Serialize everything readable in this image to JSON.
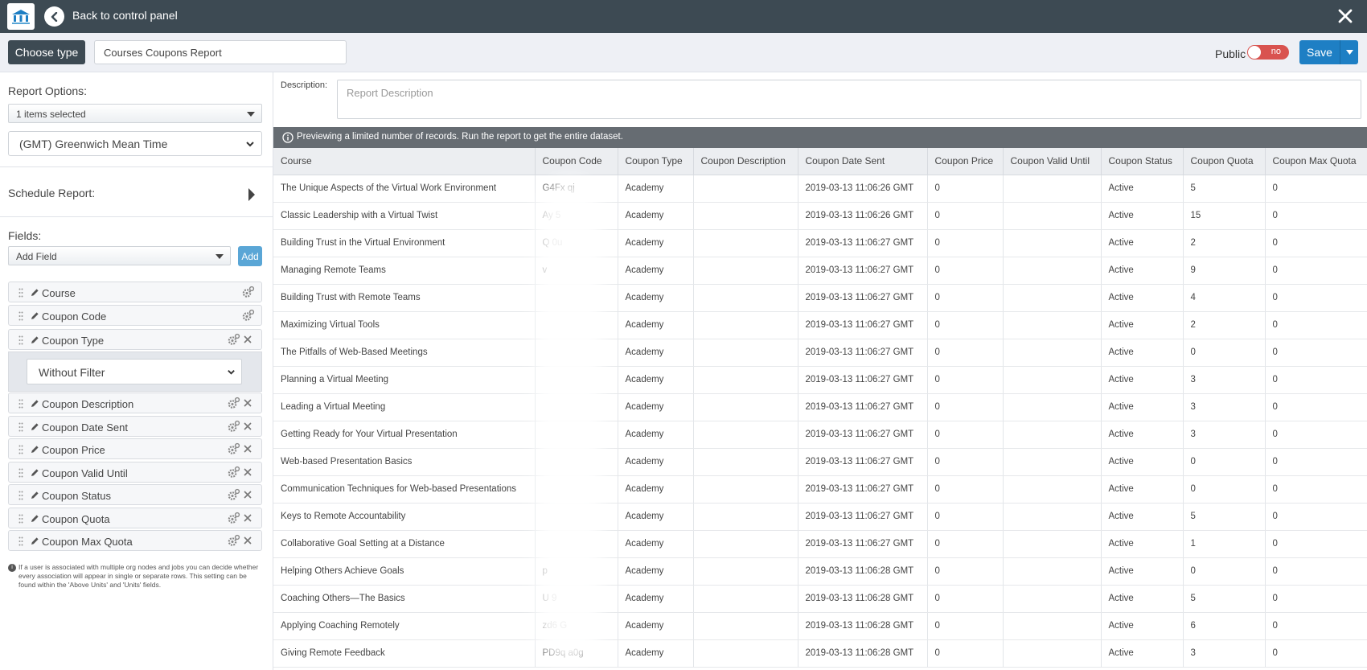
{
  "topbar": {
    "back_label": "Back to control panel"
  },
  "header": {
    "choose_type_label": "Choose type",
    "report_name": "Courses Coupons Report",
    "public_label": "Public",
    "public_toggle_text": "no",
    "save_label": "Save"
  },
  "left": {
    "report_options_title": "Report Options:",
    "items_selected": "1 items selected",
    "timezone": "(GMT) Greenwich Mean Time",
    "schedule_title": "Schedule Report:",
    "fields_title": "Fields:",
    "add_field_placeholder": "Add Field",
    "add_label": "Add",
    "fields": [
      "Course",
      "Coupon Code",
      "Coupon Type",
      "Coupon Description",
      "Coupon Date Sent",
      "Coupon Price",
      "Coupon Valid Until",
      "Coupon Status",
      "Coupon Quota",
      "Coupon Max Quota"
    ],
    "filter_value": "Without Filter",
    "note": "If a user is associated with multiple org nodes and jobs you can decide whether every association will appear in single or separate rows. This setting can be found within the 'Above Units' and 'Units' fields."
  },
  "main": {
    "description_label": "Description:",
    "description_placeholder": "Report Description",
    "banner": "Previewing a limited number of records. Run the report to get the entire dataset.",
    "columns": [
      "Course",
      "Coupon Code",
      "Coupon Type",
      "Coupon Description",
      "Coupon Date Sent",
      "Coupon Price",
      "Coupon Valid Until",
      "Coupon Status",
      "Coupon Quota",
      "Coupon Max Quota"
    ],
    "rows": [
      [
        "The Unique Aspects of the Virtual Work Environment",
        "G4Fx    qj",
        "Academy",
        "",
        "2019-03-13 11:06:26 GMT",
        "0",
        "",
        "Active",
        "5",
        "0"
      ],
      [
        "Classic Leadership with a Virtual Twist",
        "Ay       5",
        "Academy",
        "",
        "2019-03-13 11:06:26 GMT",
        "0",
        "",
        "Active",
        "15",
        "0"
      ],
      [
        "Building Trust in the Virtual Environment",
        "Q         0u",
        "Academy",
        "",
        "2019-03-13 11:06:27 GMT",
        "0",
        "",
        "Active",
        "2",
        "0"
      ],
      [
        "Managing Remote Teams",
        "v",
        "Academy",
        "",
        "2019-03-13 11:06:27 GMT",
        "0",
        "",
        "Active",
        "9",
        "0"
      ],
      [
        "Building Trust with Remote Teams",
        "",
        "Academy",
        "",
        "2019-03-13 11:06:27 GMT",
        "0",
        "",
        "Active",
        "4",
        "0"
      ],
      [
        "Maximizing Virtual Tools",
        "",
        "Academy",
        "",
        "2019-03-13 11:06:27 GMT",
        "0",
        "",
        "Active",
        "2",
        "0"
      ],
      [
        "The Pitfalls of Web-Based Meetings",
        "",
        "Academy",
        "",
        "2019-03-13 11:06:27 GMT",
        "0",
        "",
        "Active",
        "0",
        "0"
      ],
      [
        "Planning a Virtual Meeting",
        "",
        "Academy",
        "",
        "2019-03-13 11:06:27 GMT",
        "0",
        "",
        "Active",
        "3",
        "0"
      ],
      [
        "Leading a Virtual Meeting",
        "",
        "Academy",
        "",
        "2019-03-13 11:06:27 GMT",
        "0",
        "",
        "Active",
        "3",
        "0"
      ],
      [
        "Getting Ready for Your Virtual Presentation",
        "",
        "Academy",
        "",
        "2019-03-13 11:06:27 GMT",
        "0",
        "",
        "Active",
        "3",
        "0"
      ],
      [
        "Web-based Presentation Basics",
        "",
        "Academy",
        "",
        "2019-03-13 11:06:27 GMT",
        "0",
        "",
        "Active",
        "0",
        "0"
      ],
      [
        "Communication Techniques for Web-based Presentations",
        "",
        "Academy",
        "",
        "2019-03-13 11:06:27 GMT",
        "0",
        "",
        "Active",
        "0",
        "0"
      ],
      [
        "Keys to Remote Accountability",
        "",
        "Academy",
        "",
        "2019-03-13 11:06:27 GMT",
        "0",
        "",
        "Active",
        "5",
        "0"
      ],
      [
        "Collaborative Goal Setting at a Distance",
        "",
        "Academy",
        "",
        "2019-03-13 11:06:27 GMT",
        "0",
        "",
        "Active",
        "1",
        "0"
      ],
      [
        "Helping Others Achieve Goals",
        "p",
        "Academy",
        "",
        "2019-03-13 11:06:28 GMT",
        "0",
        "",
        "Active",
        "0",
        "0"
      ],
      [
        "Coaching Others—The Basics",
        "U        9",
        "Academy",
        "",
        "2019-03-13 11:06:28 GMT",
        "0",
        "",
        "Active",
        "5",
        "0"
      ],
      [
        "Applying Coaching Remotely",
        "zd6      G",
        "Academy",
        "",
        "2019-03-13 11:06:28 GMT",
        "0",
        "",
        "Active",
        "6",
        "0"
      ],
      [
        "Giving Remote Feedback",
        "PD9q   a0g",
        "Academy",
        "",
        "2019-03-13 11:06:28 GMT",
        "0",
        "",
        "Active",
        "3",
        "0"
      ]
    ]
  }
}
